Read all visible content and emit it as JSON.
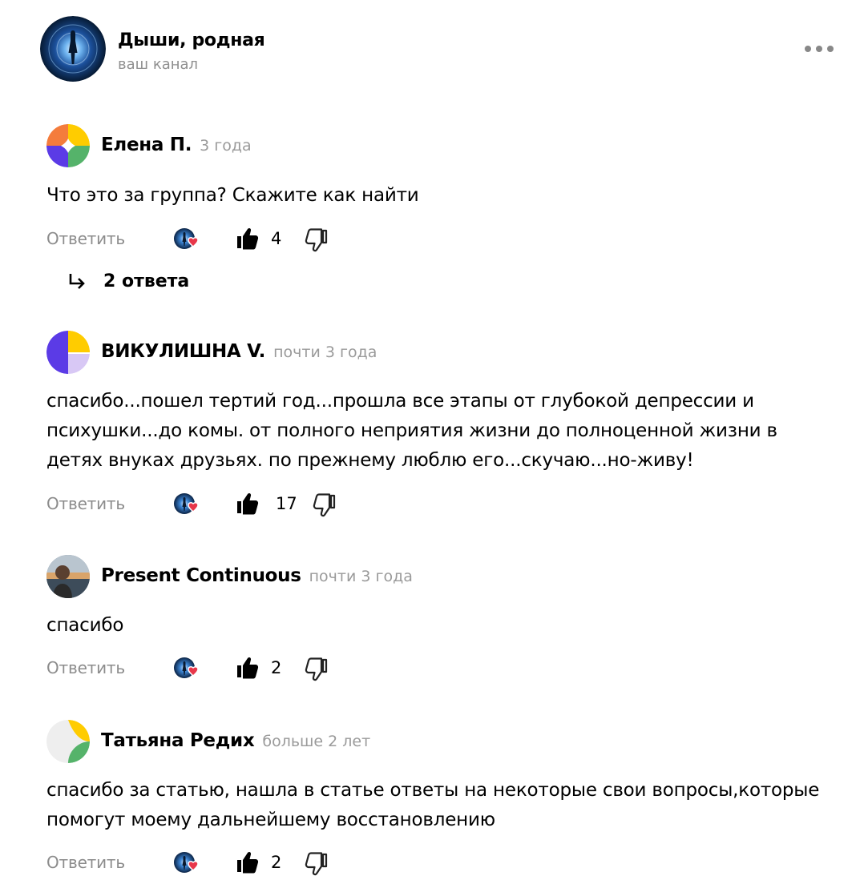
{
  "channel": {
    "name": "Дыши, родная",
    "subtitle": "ваш канал"
  },
  "colors": {
    "accent_heart": "#e8374a",
    "muted_text": "#8c8c8c",
    "date_text": "#9a9a9a"
  },
  "comments": [
    {
      "author": "Елена П.",
      "date": "3 года",
      "text": "Что это за группа? Скажите как найти",
      "reply_label": "Ответить",
      "likes": "4",
      "avatar_icon": "four-quadrant-avatar",
      "replies_label": "2 ответа"
    },
    {
      "author": "ВИКУЛИШНА V.",
      "date": "почти 3 года",
      "text_lines": [
        "спасибо...пошел тертий год...прошла все этапы от глубокой депрессии и",
        "психушки...до комы. от полного неприятия жизни до полноценной жизни в",
        "детях внуках друзьях. по прежнему люблю его...скучаю...но-живу!"
      ],
      "reply_label": "Ответить",
      "likes": "17",
      "avatar_icon": "half-circle-avatar"
    },
    {
      "author": "Present Continuous",
      "date": "почти 3 года",
      "text": "спасибо",
      "reply_label": "Ответить",
      "likes": "2",
      "avatar_icon": "photo-avatar"
    },
    {
      "author": "Татьяна Редих",
      "date": "больше 2 лет",
      "text_lines": [
        "спасибо за статью, нашла в статье ответы на некоторые свои вопросы,которые",
        "помогут моему дальнейшему восстановлению"
      ],
      "reply_label": "Ответить",
      "likes": "2",
      "avatar_icon": "leaf-avatar"
    }
  ]
}
